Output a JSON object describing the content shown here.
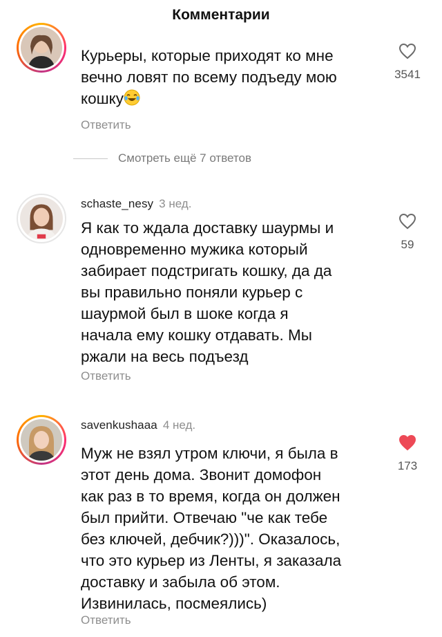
{
  "header": {
    "title": "Комментарии"
  },
  "comments": [
    {
      "username": "",
      "time": "",
      "text": "Курьеры, которые приходят ко мне\nвечно ловят по всему подъеду мою\nкошку",
      "emoji": "laughing-tears-emoji",
      "likes": "3541",
      "liked": false,
      "reply_label": "Ответить"
    },
    {
      "username": "schaste_nesy",
      "time": "3 нед.",
      "text": "Я как то ждала доставку шаурмы и\nодновременно мужика который\nзабирает подстригать кошку, да да\nвы правильно поняли курьер с\nшаурмой был в шоке когда я\nначала ему кошку отдавать. Мы\nржали на весь подъезд",
      "likes": "59",
      "liked": false,
      "reply_label": "Ответить"
    },
    {
      "username": "savenkushaaa",
      "time": "4 нед.",
      "text": "Муж не взял утром ключи, я была в\nэтот день дома. Звонит домофон\nкак раз в то время, когда он должен\nбыл прийти. Отвечаю \"че как тебе\nбез ключей, дебчик?)))\". Оказалось,\nчто это курьер из Ленты, я заказала\nдоставку и забыла об этом.\nИзвинилась, посмеялись)",
      "likes": "173",
      "liked": true,
      "reply_label": "Ответить"
    }
  ],
  "view_more_replies": "Смотреть ещё 7 ответов",
  "colors": {
    "like_active": "#ed4956",
    "secondary_text": "#8e8e8e"
  }
}
